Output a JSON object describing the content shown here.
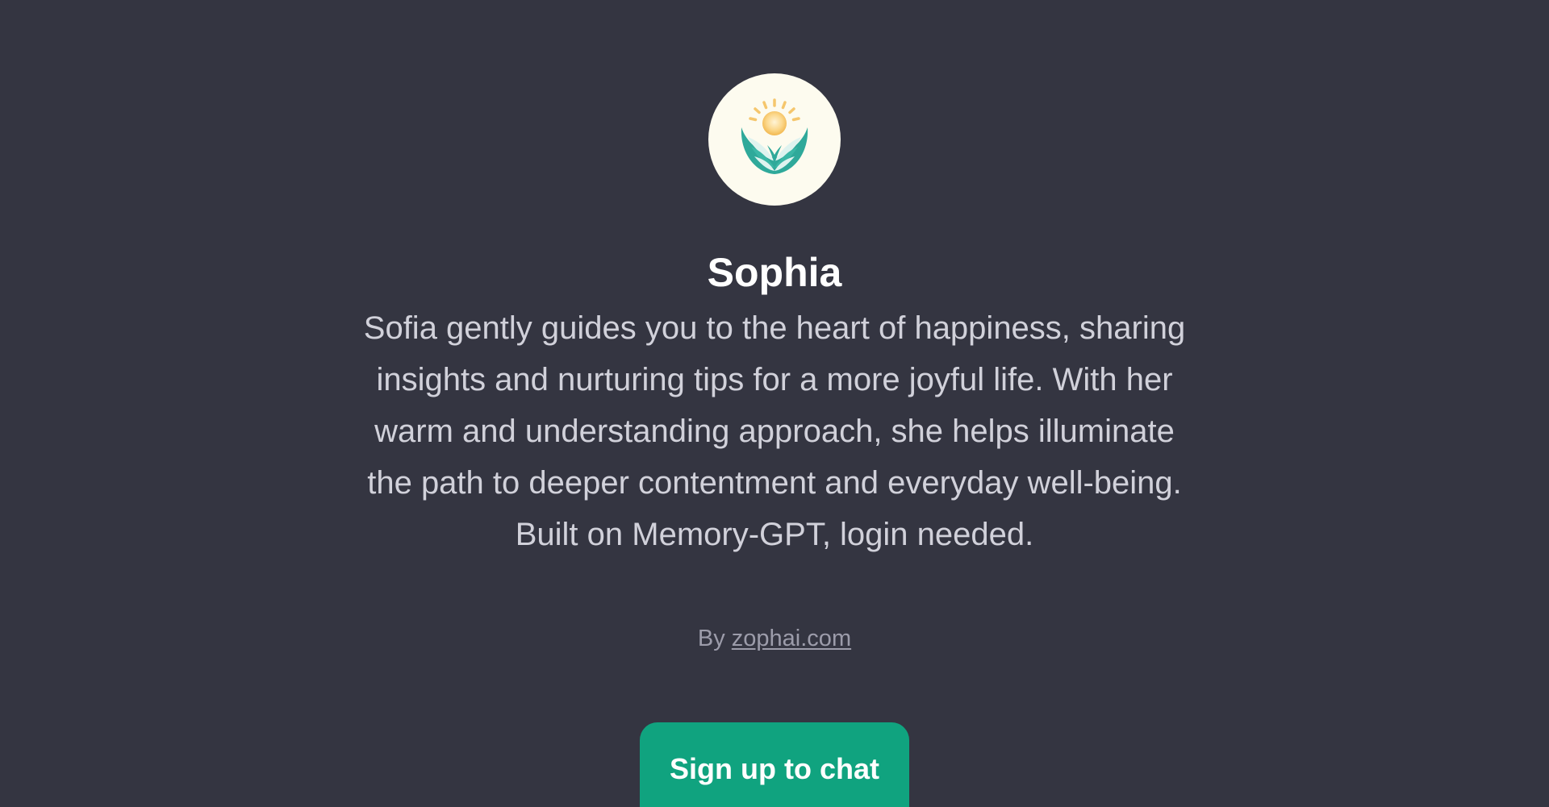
{
  "gpt": {
    "avatar_icon": "sun-over-leaves-logo-icon",
    "name": "Sophia",
    "description": "Sofia gently guides you to the heart of happiness, sharing insights and nurturing tips for a more joyful life. With her warm and understanding approach, she helps illuminate the path to deeper contentment and everyday well-being. Built on Memory-GPT, login needed.",
    "author_prefix": "By",
    "author_link": "zophai.com"
  },
  "actions": {
    "signup_label": "Sign up to chat"
  },
  "colors": {
    "background": "#343541",
    "accent": "#10a37f",
    "avatar_bg": "#fdfbef",
    "leaf": "#2fa99a",
    "sun": "#f7c86a"
  }
}
